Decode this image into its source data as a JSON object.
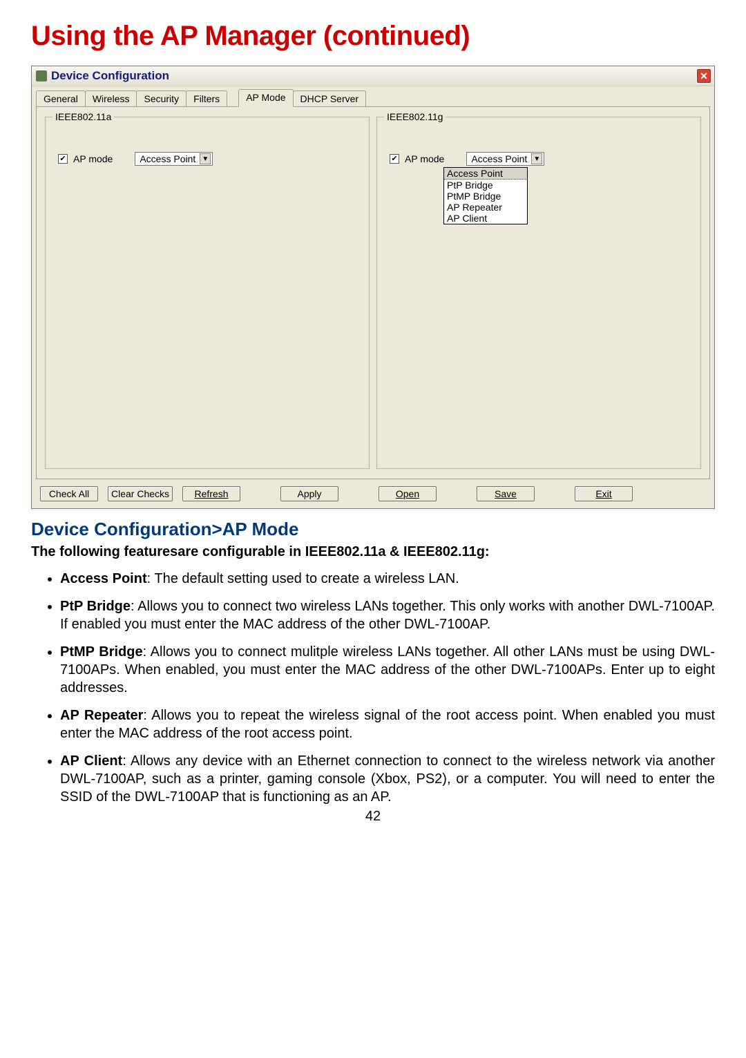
{
  "page_title": "Using the AP Manager (continued)",
  "window_title": "Device Configuration",
  "tabs": [
    "General",
    "Wireless",
    "Security",
    "Filters",
    "AP Mode",
    "DHCP Server"
  ],
  "active_tab_index": 4,
  "group_a": {
    "legend": "IEEE802.11a",
    "checkbox_label": "AP mode",
    "checked": true,
    "combo_value": "Access Point"
  },
  "group_g": {
    "legend": "IEEE802.11g",
    "checkbox_label": "AP mode",
    "checked": true,
    "combo_value": "Access Point",
    "list_options": [
      "Access Point",
      "PtP Bridge",
      "PtMP Bridge",
      "AP Repeater",
      "AP Client"
    ],
    "selected_option_index": 0
  },
  "buttons": [
    "Check All",
    "Clear Checks",
    "Refresh",
    "Apply",
    "Open",
    "Save",
    "Exit"
  ],
  "section_title": "Device Configuration>AP Mode",
  "intro_bold": "The following featuresare configurable in IEEE802.11a & IEEE802.11g:",
  "bullets": [
    {
      "term": "Access Point",
      "text": ": The default setting used to create a wireless LAN."
    },
    {
      "term": "PtP Bridge",
      "text": ": Allows you to connect two wireless LANs together. This only works with another DWL-7100AP. If enabled you must enter the MAC address of the other DWL-7100AP."
    },
    {
      "term": "PtMP Bridge",
      "text": ": Allows you to connect mulitple wireless LANs together. All other LANs must be using DWL-7100APs. When enabled, you must enter the MAC address of the other DWL-7100APs. Enter up to eight addresses."
    },
    {
      "term": "AP Repeater",
      "text": ": Allows you to repeat the wireless signal of the root access point. When enabled you must enter the MAC address of the root access point."
    },
    {
      "term": "AP Client",
      "text": ": Allows any device with an Ethernet connection to connect to the wireless network via another DWL-7100AP, such as a printer, gaming console (Xbox, PS2), or a computer. You will need to enter the SSID of the DWL-7100AP that is functioning as an AP."
    }
  ],
  "page_number": "42"
}
